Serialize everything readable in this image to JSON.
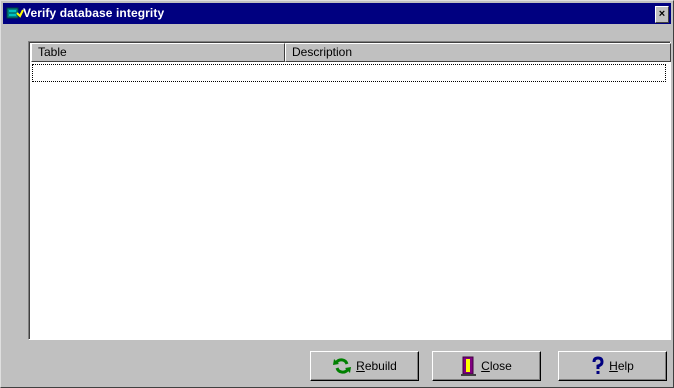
{
  "window": {
    "title": "Verify database integrity",
    "close_glyph": "×",
    "icon": "database-check-icon"
  },
  "list": {
    "columns": [
      {
        "label": "Table"
      },
      {
        "label": "Description"
      }
    ],
    "rows": []
  },
  "buttons": {
    "rebuild": {
      "accel": "R",
      "rest": "ebuild",
      "icon": "refresh-icon",
      "color": "#008000"
    },
    "close": {
      "accel": "C",
      "rest": "lose",
      "icon": "door-exit-icon",
      "color": "#800080"
    },
    "help": {
      "accel": "H",
      "rest": "elp",
      "icon": "question-icon",
      "color": "#000080"
    }
  }
}
